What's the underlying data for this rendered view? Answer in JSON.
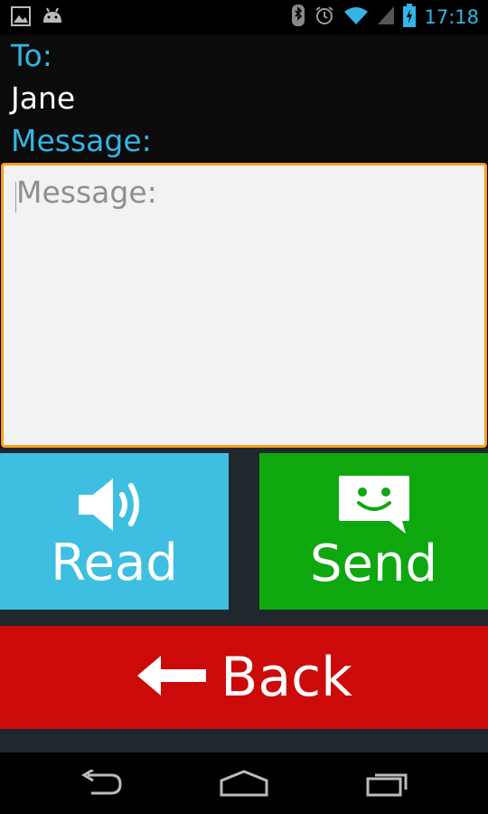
{
  "status_bar": {
    "time": "17:18",
    "left_icons": [
      "gallery-icon",
      "android-icon"
    ],
    "right_icons": [
      "bluetooth-icon",
      "alarm-icon",
      "wifi-icon",
      "signal-icon",
      "battery-charging-icon"
    ]
  },
  "compose": {
    "to_label": "To:",
    "recipient": "Jane",
    "message_label": "Message:",
    "message_placeholder": "Message:",
    "message_value": ""
  },
  "actions": {
    "read_label": "Read",
    "send_label": "Send",
    "back_label": "Back",
    "read_icon": "speaker-icon",
    "send_icon": "smiley-message-icon",
    "back_icon": "arrow-left-icon"
  },
  "nav_bar": {
    "buttons": [
      "back-nav-icon",
      "home-nav-icon",
      "recents-nav-icon"
    ]
  },
  "colors": {
    "accent_blue": "#33b5e5",
    "read_button": "#3ebfe1",
    "send_button": "#0ea80e",
    "back_button": "#cc0a0a",
    "focus_border": "#ff9e19"
  }
}
